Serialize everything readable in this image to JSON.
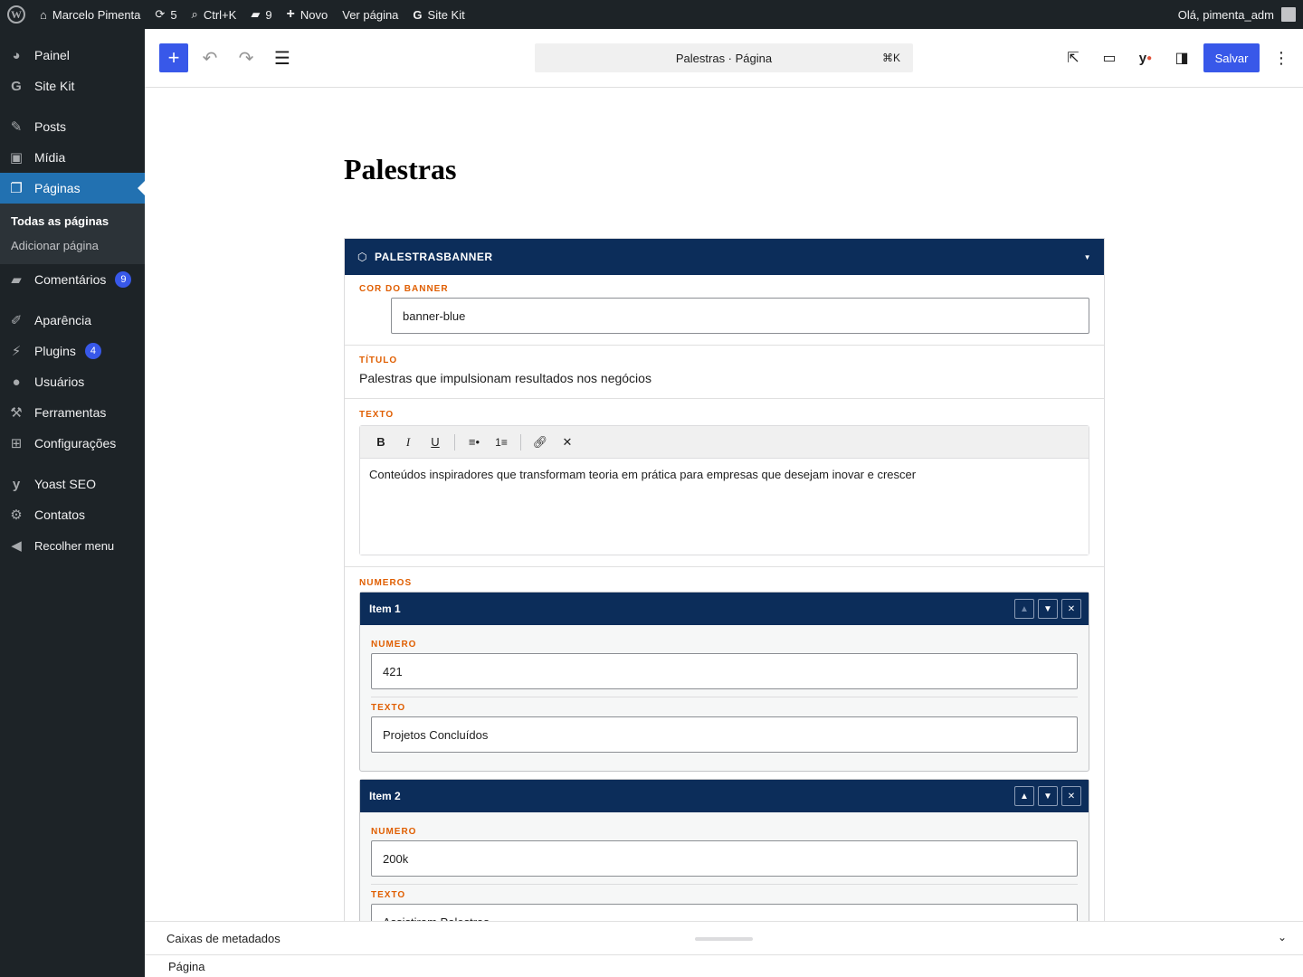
{
  "adminbar": {
    "site_name": "Marcelo Pimenta",
    "updates_count": "5",
    "search_shortcut": "Ctrl+K",
    "comments_count": "9",
    "new_label": "Novo",
    "view_page": "Ver página",
    "site_kit": "Site Kit",
    "greeting": "Olá, pimenta_adm"
  },
  "sidebar": {
    "items": [
      {
        "label": "Painel"
      },
      {
        "label": "Site Kit"
      },
      {
        "label": "Posts"
      },
      {
        "label": "Mídia"
      },
      {
        "label": "Páginas"
      },
      {
        "label": "Comentários",
        "badge": "9"
      },
      {
        "label": "Aparência"
      },
      {
        "label": "Plugins",
        "badge": "4"
      },
      {
        "label": "Usuários"
      },
      {
        "label": "Ferramentas"
      },
      {
        "label": "Configurações"
      },
      {
        "label": "Yoast SEO"
      },
      {
        "label": "Contatos"
      },
      {
        "label": "Recolher menu"
      }
    ],
    "submenu": [
      "Todas as páginas",
      "Adicionar página"
    ]
  },
  "header": {
    "document_title": "Palestras · Página",
    "command_shortcut": "⌘K",
    "save_label": "Salvar"
  },
  "editor": {
    "page_title": "Palestras",
    "block_name": "PALESTRASBANNER",
    "fields": {
      "cor_label": "COR DO BANNER",
      "cor_value": "banner-blue",
      "titulo_label": "TÍTULO",
      "titulo_value": "Palestras que impulsionam resultados nos negócios",
      "texto_label": "TEXTO",
      "texto_value": "Conteúdos inspiradores que transformam teoria em prática para empresas que desejam inovar e crescer",
      "numeros_label": "NUMEROS"
    },
    "repeater": [
      {
        "title": "Item 1",
        "numero_label": "NUMERO",
        "numero": "421",
        "texto_label": "TEXTO",
        "texto": "Projetos Concluídos"
      },
      {
        "title": "Item 2",
        "numero_label": "NUMERO",
        "numero": "200k",
        "texto_label": "TEXTO",
        "texto": "Assistiram Palestras"
      }
    ]
  },
  "footer": {
    "metaboxes": "Caixas de metadados",
    "breadcrumb": "Página"
  },
  "colors": {
    "accent": "#3858e9",
    "block_header": "#0c2d5a",
    "field_label": "#e05e00",
    "admin_dark": "#1d2327"
  }
}
